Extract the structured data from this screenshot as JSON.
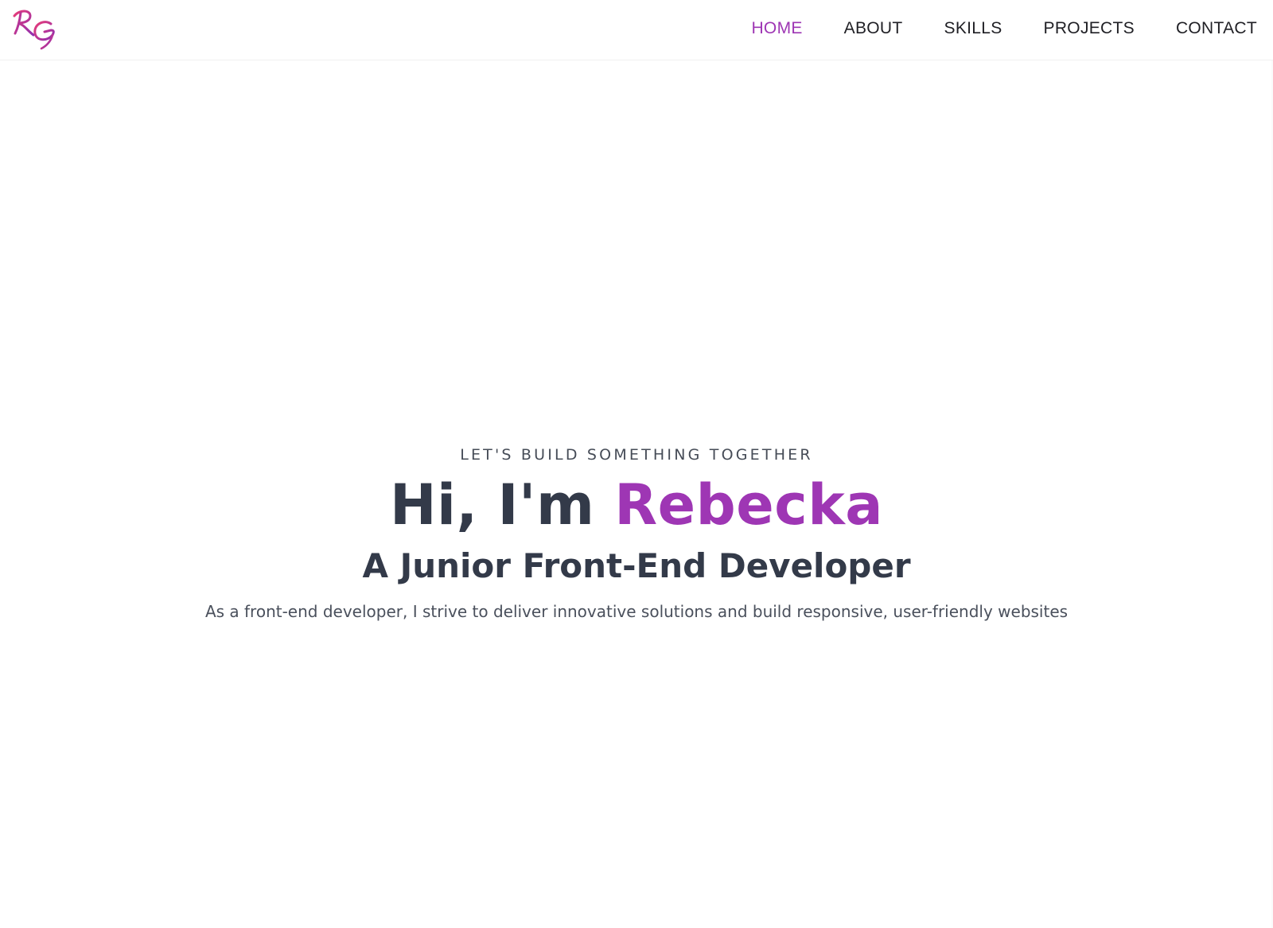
{
  "logo": {
    "initials": "RG",
    "colors": [
      "#e83c78",
      "#8e2fb1"
    ]
  },
  "nav": {
    "items": [
      {
        "label": "HOME",
        "active": true
      },
      {
        "label": "ABOUT",
        "active": false
      },
      {
        "label": "SKILLS",
        "active": false
      },
      {
        "label": "PROJECTS",
        "active": false
      },
      {
        "label": "CONTACT",
        "active": false
      }
    ]
  },
  "hero": {
    "eyebrow": "LET'S BUILD SOMETHING TOGETHER",
    "greeting": "Hi, I'm ",
    "name": "Rebecka",
    "role": "A Junior Front-End Developer",
    "tagline": "As a front-end developer, I strive to deliver innovative solutions and build responsive, user-friendly websites"
  },
  "colors": {
    "accent": "#9e36b4",
    "heading": "#333a49",
    "nav_text": "#1f1f24",
    "body_text": "#4a505c",
    "background": "#ffffff"
  }
}
